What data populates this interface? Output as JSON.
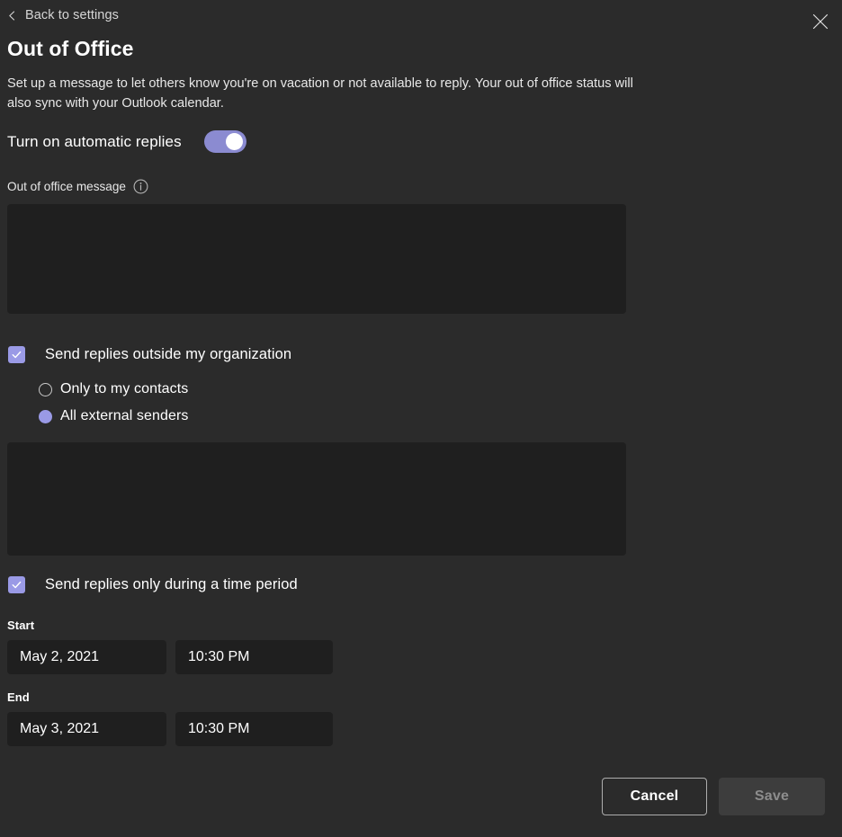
{
  "header": {
    "back_label": "Back to settings",
    "back_icon": "chevron-left-icon",
    "close_icon": "close-icon",
    "title": "Out of Office",
    "description": "Set up a message to let others know you're on vacation or not available to reply. Your out of office status will also sync with your Outlook calendar."
  },
  "automatic_replies": {
    "label": "Turn on automatic replies",
    "enabled": true,
    "accent_color": "#8b8bd1"
  },
  "internal_message": {
    "label": "Out of office message",
    "info_icon": "info-circle-icon",
    "value": "",
    "placeholder": ""
  },
  "outside_org": {
    "label": "Send replies outside my organization",
    "checked": true,
    "check_icon": "checkmark-icon",
    "options": [
      {
        "label": "Only to my contacts",
        "selected": false
      },
      {
        "label": "All external senders",
        "selected": true
      }
    ]
  },
  "external_message": {
    "value": "",
    "placeholder": ""
  },
  "time_period": {
    "label": "Send replies only during a time period",
    "checked": true,
    "check_icon": "checkmark-icon",
    "start": {
      "label": "Start",
      "date": "May 2, 2021",
      "time": "10:30 PM"
    },
    "end": {
      "label": "End",
      "date": "May 3, 2021",
      "time": "10:30 PM"
    }
  },
  "footer": {
    "cancel_label": "Cancel",
    "save_label": "Save",
    "save_disabled": true
  },
  "colors": {
    "page_background": "#2b2b2b",
    "field_background": "#1f1f1f",
    "accent": "#9a9ae6",
    "disabled_text": "#8d8d8d"
  }
}
